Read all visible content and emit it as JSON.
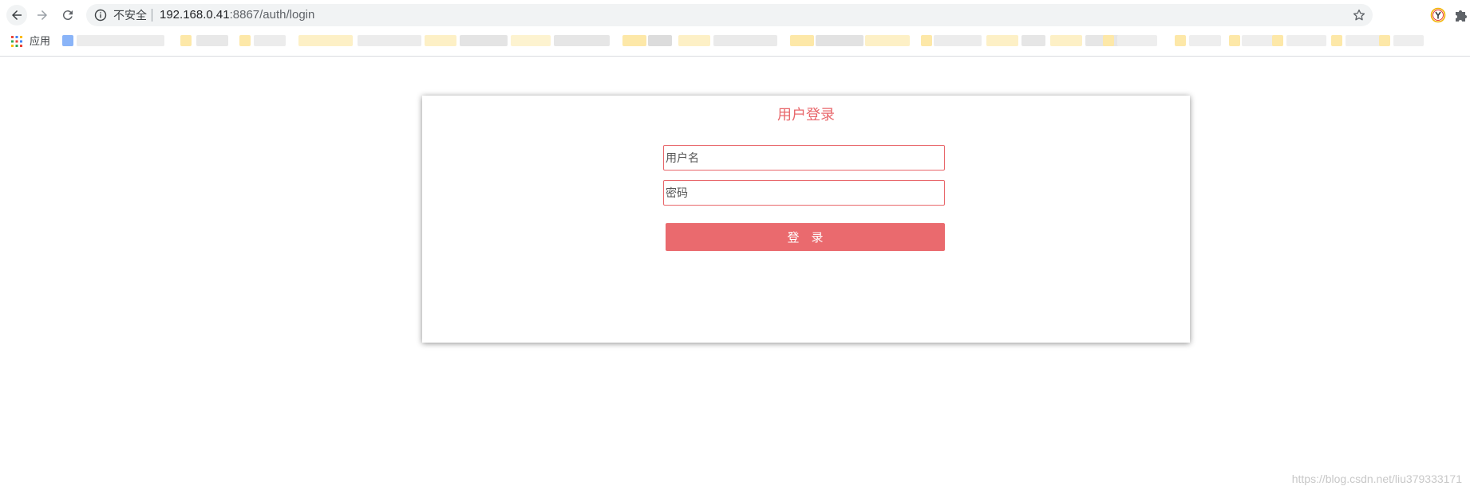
{
  "browser": {
    "security_label": "不安全",
    "url_host": "192.168.0.41",
    "url_port_path": ":8867/auth/login",
    "bookmarks_apps_label": "应用"
  },
  "login": {
    "title": "用户登录",
    "username_placeholder": "用户名",
    "password_placeholder": "密码",
    "submit_label": "登　录"
  },
  "watermark": "https://blog.csdn.net/liu379333171",
  "colors": {
    "accent": "#e8676b",
    "button": "#ea6a6e"
  },
  "icons": {
    "back": "arrow-left-icon",
    "forward": "arrow-right-icon",
    "reload": "reload-icon",
    "info": "info-icon",
    "star": "star-icon",
    "extension": "puzzle-icon"
  }
}
